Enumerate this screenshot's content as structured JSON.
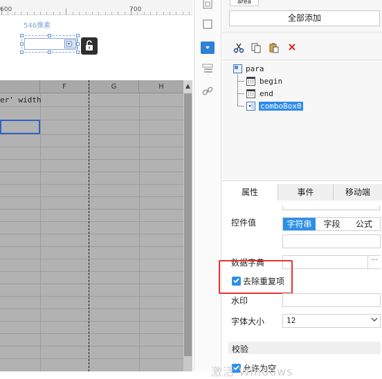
{
  "ruler": {
    "labels": [
      "600",
      "700"
    ]
  },
  "canvas": {
    "size_label": "546像素",
    "lock_icon": "unlock-icon",
    "columns": [
      "F",
      "G",
      "H"
    ],
    "cell_text": "er' width",
    "scroll_up_glyph": "▲"
  },
  "toolbar_strip": {
    "icons": [
      "layout-icon",
      "frame-icon",
      "combobox-widget-icon",
      "list-icon",
      "link-icon"
    ]
  },
  "panel": {
    "area_tag": "area",
    "add_all_label": "全部添加",
    "tools": [
      "cut-icon",
      "copy-icon",
      "paste-icon",
      "delete-icon"
    ],
    "tree": {
      "root": "para",
      "children": [
        "begin",
        "end",
        "comboBox0"
      ]
    },
    "tabs": [
      "属性",
      "事件",
      "移动端"
    ],
    "props": {
      "control_value_label": "控件值",
      "segments": [
        "字符串",
        "字段",
        "公式"
      ],
      "active_segment": "字符串",
      "data_dict_label": "数据字典",
      "dict_button": "···",
      "remove_dup_label": "去除重复项",
      "watermark_label": "水印",
      "font_size_label": "字体大小",
      "font_size_value": "12",
      "validation_label": "校验",
      "allow_empty_label": "允许为空"
    },
    "watermark_text": "激活 Windows",
    "colors": {
      "accent": "#2f8fe6",
      "highlight_box": "#e53232"
    }
  }
}
